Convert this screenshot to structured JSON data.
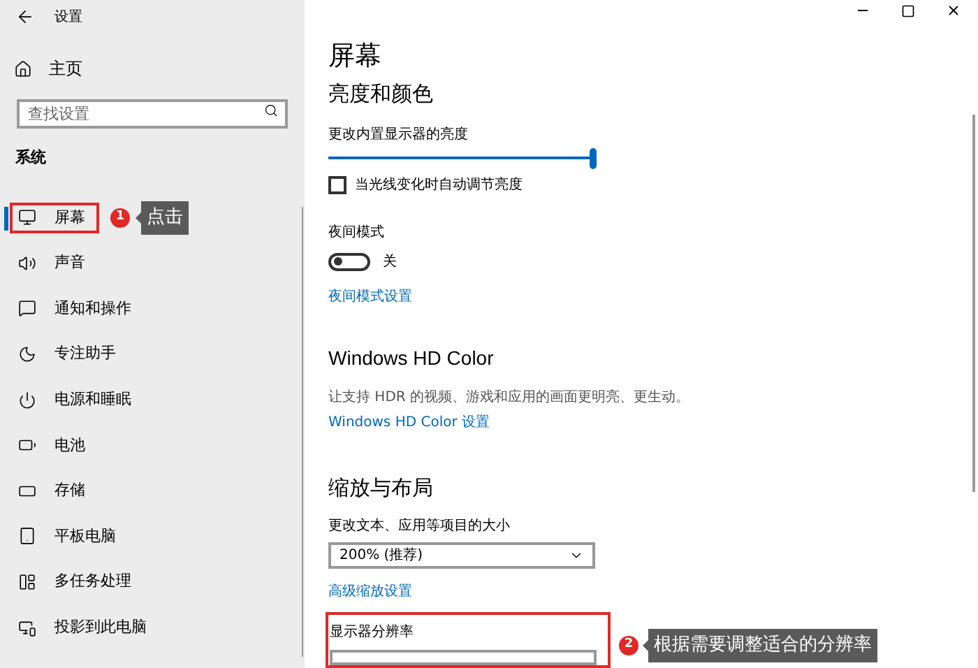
{
  "window": {
    "title": "设置"
  },
  "sidebar": {
    "home": "主页",
    "search": {
      "placeholder": "查找设置"
    },
    "section": "系统",
    "items": [
      {
        "label": "屏幕",
        "selected": true
      },
      {
        "label": "声音",
        "selected": false
      },
      {
        "label": "通知和操作",
        "selected": false
      },
      {
        "label": "专注助手",
        "selected": false
      },
      {
        "label": "电源和睡眠",
        "selected": false
      },
      {
        "label": "电池",
        "selected": false
      },
      {
        "label": "存储",
        "selected": false
      },
      {
        "label": "平板电脑",
        "selected": false
      },
      {
        "label": "多任务处理",
        "selected": false
      },
      {
        "label": "投影到此电脑",
        "selected": false
      }
    ]
  },
  "annotations": [
    {
      "number": "1",
      "text": "点击"
    },
    {
      "number": "2",
      "text": "根据需要调整适合的分辨率"
    }
  ],
  "content": {
    "title": "屏幕",
    "brightness": {
      "heading": "亮度和颜色",
      "slider_label": "更改内置显示器的亮度",
      "level": 1,
      "auto_label": "当光线变化时自动调节亮度",
      "auto_checked": false
    },
    "night": {
      "label": "夜间模式",
      "on": false,
      "state_text": "关",
      "link": "夜间模式设置"
    },
    "hdr": {
      "heading": "Windows HD Color",
      "description": "让支持 HDR 的视频、游戏和应用的画面更明亮、更生动。",
      "link": "Windows HD Color 设置"
    },
    "scale": {
      "heading": "缩放与布局",
      "size_label": "更改文本、应用等项目的大小",
      "size_value": "200% (推荐)",
      "advanced_link": "高级缩放设置",
      "resolution_label": "显示器分辨率"
    }
  }
}
